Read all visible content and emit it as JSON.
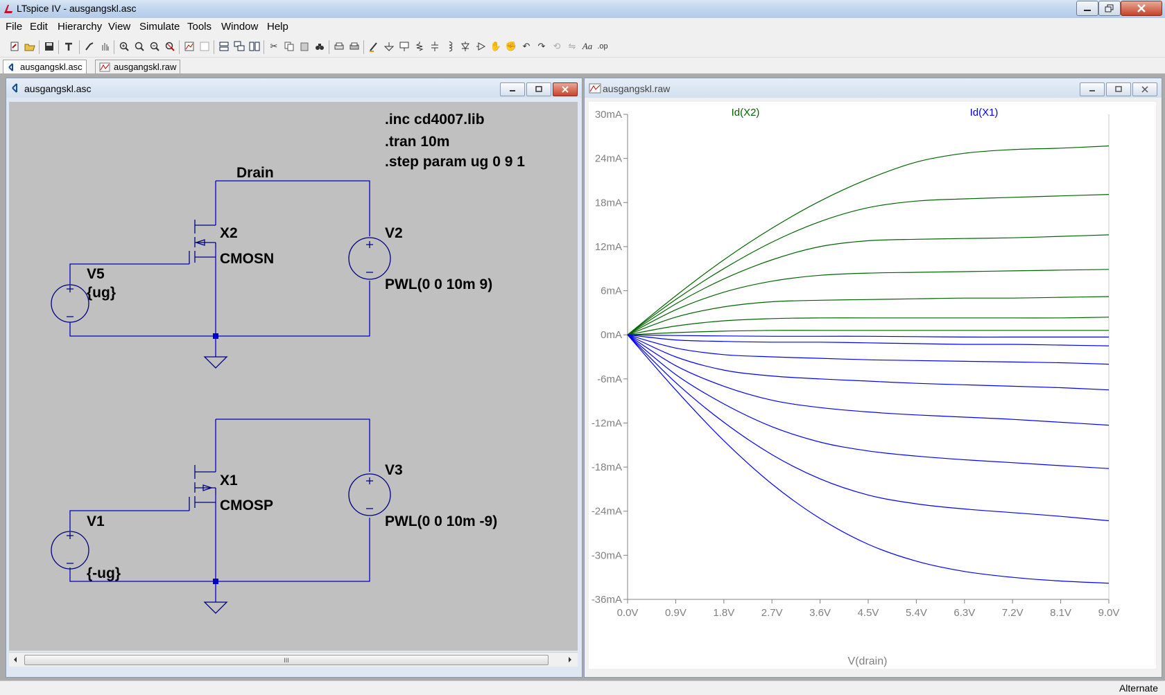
{
  "window": {
    "title": "LTspice IV - ausgangskl.asc"
  },
  "menu": [
    "File",
    "Edit",
    "Hierarchy",
    "View",
    "Simulate",
    "Tools",
    "Window",
    "Help"
  ],
  "tabs": [
    {
      "label": "ausgangskl.asc",
      "active": true
    },
    {
      "label": "ausgangskl.raw",
      "active": false
    }
  ],
  "schematic_window": {
    "title": "ausgangskl.asc",
    "directives": [
      ".inc cd4007.lib",
      ".tran 10m",
      ".step param ug 0 9 1"
    ],
    "net_label": "Drain",
    "parts": {
      "x2": {
        "name": "X2",
        "model": "CMOSN"
      },
      "x1": {
        "name": "X1",
        "model": "CMOSP"
      },
      "v5": {
        "name": "V5",
        "value": "{ug}"
      },
      "v1": {
        "name": "V1",
        "value": "{-ug}"
      },
      "v2": {
        "name": "V2",
        "value": "PWL(0 0 10m 9)"
      },
      "v3": {
        "name": "V3",
        "value": "PWL(0 0 10m -9)"
      }
    },
    "scrollbar_grip": "III"
  },
  "waveform_window": {
    "title": "ausgangskl.raw",
    "trace_labels": [
      "Id(X2)",
      "Id(X1)"
    ]
  },
  "status": {
    "text": "Alternate"
  },
  "colors": {
    "wire": "#0000c8",
    "trace_x2": "#006400",
    "trace_x1": "#0000ff",
    "schematic_bg": "#c0c0c0"
  },
  "chart_data": {
    "type": "line",
    "xlabel": "V(drain)",
    "ylabel": "",
    "xlim": [
      0,
      9
    ],
    "ylim": [
      -36,
      30
    ],
    "x_ticks": [
      "0.0V",
      "0.9V",
      "1.8V",
      "2.7V",
      "3.6V",
      "4.5V",
      "5.4V",
      "6.3V",
      "7.2V",
      "8.1V",
      "9.0V"
    ],
    "y_ticks": [
      "30mA",
      "24mA",
      "18mA",
      "12mA",
      "6mA",
      "0mA",
      "-6mA",
      "-12mA",
      "-18mA",
      "-24mA",
      "-30mA",
      "-36mA"
    ],
    "grid": false,
    "x": [
      0,
      0.9,
      1.8,
      2.7,
      3.6,
      4.5,
      5.4,
      6.3,
      7.2,
      8.1,
      9.0
    ],
    "series": [
      {
        "name": "Id(X2)",
        "color": "#006400",
        "values": [
          0,
          0.3,
          0.5,
          0.6,
          0.6,
          0.6,
          0.6,
          0.6,
          0.6,
          0.6,
          0.6
        ]
      },
      {
        "name": "Id(X2)",
        "color": "#006400",
        "values": [
          0,
          1.2,
          1.9,
          2.2,
          2.3,
          2.3,
          2.3,
          2.3,
          2.3,
          2.3,
          2.4
        ]
      },
      {
        "name": "Id(X2)",
        "color": "#006400",
        "values": [
          0,
          2.4,
          3.8,
          4.5,
          4.7,
          4.8,
          4.9,
          5.0,
          5.0,
          5.1,
          5.2
        ]
      },
      {
        "name": "Id(X2)",
        "color": "#006400",
        "values": [
          0,
          3.4,
          5.8,
          7.3,
          8.1,
          8.4,
          8.5,
          8.6,
          8.7,
          8.8,
          8.9
        ]
      },
      {
        "name": "Id(X2)",
        "color": "#006400",
        "values": [
          0,
          4.2,
          7.6,
          10.2,
          12.0,
          12.8,
          13.0,
          13.1,
          13.2,
          13.4,
          13.6
        ]
      },
      {
        "name": "Id(X2)",
        "color": "#006400",
        "values": [
          0,
          4.8,
          9.0,
          12.6,
          15.4,
          17.3,
          18.2,
          18.5,
          18.7,
          18.9,
          19.1
        ]
      },
      {
        "name": "Id(X2)",
        "color": "#006400",
        "values": [
          0,
          5.3,
          10.2,
          14.5,
          18.2,
          21.2,
          23.5,
          24.7,
          25.2,
          25.4,
          25.7
        ]
      },
      {
        "name": "Id(X1)",
        "color": "#0000ff",
        "values": [
          0,
          -0.1,
          -0.15,
          -0.2,
          -0.2,
          -0.2,
          -0.25,
          -0.3,
          -0.3,
          -0.3,
          -0.3
        ]
      },
      {
        "name": "Id(X1)",
        "color": "#0000ff",
        "values": [
          0,
          -0.7,
          -0.9,
          -1.0,
          -1.0,
          -1.1,
          -1.2,
          -1.3,
          -1.3,
          -1.4,
          -1.5
        ]
      },
      {
        "name": "Id(X1)",
        "color": "#0000ff",
        "values": [
          0,
          -1.8,
          -2.7,
          -3.0,
          -3.2,
          -3.4,
          -3.5,
          -3.6,
          -3.7,
          -3.8,
          -4.0
        ]
      },
      {
        "name": "Id(X1)",
        "color": "#0000ff",
        "values": [
          0,
          -3.0,
          -4.8,
          -5.6,
          -6.0,
          -6.3,
          -6.6,
          -6.8,
          -7.0,
          -7.2,
          -7.5
        ]
      },
      {
        "name": "Id(X1)",
        "color": "#0000ff",
        "values": [
          0,
          -4.2,
          -7.0,
          -8.9,
          -9.9,
          -10.5,
          -10.9,
          -11.2,
          -11.5,
          -11.9,
          -12.3
        ]
      },
      {
        "name": "Id(X1)",
        "color": "#0000ff",
        "values": [
          0,
          -5.4,
          -9.4,
          -12.5,
          -14.6,
          -15.8,
          -16.5,
          -17.0,
          -17.4,
          -17.8,
          -18.2
        ]
      },
      {
        "name": "Id(X1)",
        "color": "#0000ff",
        "values": [
          0,
          -6.5,
          -11.9,
          -16.3,
          -19.6,
          -21.8,
          -23.0,
          -23.7,
          -24.2,
          -24.7,
          -25.3
        ]
      },
      {
        "name": "Id(X1)",
        "color": "#0000ff",
        "values": [
          0,
          -7.5,
          -14.4,
          -20.3,
          -25.0,
          -28.5,
          -30.8,
          -32.2,
          -33.0,
          -33.5,
          -33.8
        ]
      }
    ]
  }
}
